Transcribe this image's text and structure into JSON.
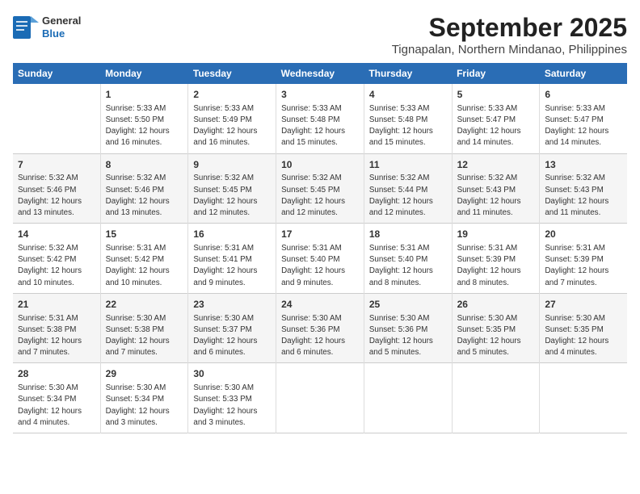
{
  "logo": {
    "line1": "General",
    "line2": "Blue"
  },
  "title": "September 2025",
  "subtitle": "Tignapalan, Northern Mindanao, Philippines",
  "days_header": [
    "Sunday",
    "Monday",
    "Tuesday",
    "Wednesday",
    "Thursday",
    "Friday",
    "Saturday"
  ],
  "weeks": [
    [
      {
        "day": "",
        "info": ""
      },
      {
        "day": "1",
        "info": "Sunrise: 5:33 AM\nSunset: 5:50 PM\nDaylight: 12 hours\nand 16 minutes."
      },
      {
        "day": "2",
        "info": "Sunrise: 5:33 AM\nSunset: 5:49 PM\nDaylight: 12 hours\nand 16 minutes."
      },
      {
        "day": "3",
        "info": "Sunrise: 5:33 AM\nSunset: 5:48 PM\nDaylight: 12 hours\nand 15 minutes."
      },
      {
        "day": "4",
        "info": "Sunrise: 5:33 AM\nSunset: 5:48 PM\nDaylight: 12 hours\nand 15 minutes."
      },
      {
        "day": "5",
        "info": "Sunrise: 5:33 AM\nSunset: 5:47 PM\nDaylight: 12 hours\nand 14 minutes."
      },
      {
        "day": "6",
        "info": "Sunrise: 5:33 AM\nSunset: 5:47 PM\nDaylight: 12 hours\nand 14 minutes."
      }
    ],
    [
      {
        "day": "7",
        "info": "Sunrise: 5:32 AM\nSunset: 5:46 PM\nDaylight: 12 hours\nand 13 minutes."
      },
      {
        "day": "8",
        "info": "Sunrise: 5:32 AM\nSunset: 5:46 PM\nDaylight: 12 hours\nand 13 minutes."
      },
      {
        "day": "9",
        "info": "Sunrise: 5:32 AM\nSunset: 5:45 PM\nDaylight: 12 hours\nand 12 minutes."
      },
      {
        "day": "10",
        "info": "Sunrise: 5:32 AM\nSunset: 5:45 PM\nDaylight: 12 hours\nand 12 minutes."
      },
      {
        "day": "11",
        "info": "Sunrise: 5:32 AM\nSunset: 5:44 PM\nDaylight: 12 hours\nand 12 minutes."
      },
      {
        "day": "12",
        "info": "Sunrise: 5:32 AM\nSunset: 5:43 PM\nDaylight: 12 hours\nand 11 minutes."
      },
      {
        "day": "13",
        "info": "Sunrise: 5:32 AM\nSunset: 5:43 PM\nDaylight: 12 hours\nand 11 minutes."
      }
    ],
    [
      {
        "day": "14",
        "info": "Sunrise: 5:32 AM\nSunset: 5:42 PM\nDaylight: 12 hours\nand 10 minutes."
      },
      {
        "day": "15",
        "info": "Sunrise: 5:31 AM\nSunset: 5:42 PM\nDaylight: 12 hours\nand 10 minutes."
      },
      {
        "day": "16",
        "info": "Sunrise: 5:31 AM\nSunset: 5:41 PM\nDaylight: 12 hours\nand 9 minutes."
      },
      {
        "day": "17",
        "info": "Sunrise: 5:31 AM\nSunset: 5:40 PM\nDaylight: 12 hours\nand 9 minutes."
      },
      {
        "day": "18",
        "info": "Sunrise: 5:31 AM\nSunset: 5:40 PM\nDaylight: 12 hours\nand 8 minutes."
      },
      {
        "day": "19",
        "info": "Sunrise: 5:31 AM\nSunset: 5:39 PM\nDaylight: 12 hours\nand 8 minutes."
      },
      {
        "day": "20",
        "info": "Sunrise: 5:31 AM\nSunset: 5:39 PM\nDaylight: 12 hours\nand 7 minutes."
      }
    ],
    [
      {
        "day": "21",
        "info": "Sunrise: 5:31 AM\nSunset: 5:38 PM\nDaylight: 12 hours\nand 7 minutes."
      },
      {
        "day": "22",
        "info": "Sunrise: 5:30 AM\nSunset: 5:38 PM\nDaylight: 12 hours\nand 7 minutes."
      },
      {
        "day": "23",
        "info": "Sunrise: 5:30 AM\nSunset: 5:37 PM\nDaylight: 12 hours\nand 6 minutes."
      },
      {
        "day": "24",
        "info": "Sunrise: 5:30 AM\nSunset: 5:36 PM\nDaylight: 12 hours\nand 6 minutes."
      },
      {
        "day": "25",
        "info": "Sunrise: 5:30 AM\nSunset: 5:36 PM\nDaylight: 12 hours\nand 5 minutes."
      },
      {
        "day": "26",
        "info": "Sunrise: 5:30 AM\nSunset: 5:35 PM\nDaylight: 12 hours\nand 5 minutes."
      },
      {
        "day": "27",
        "info": "Sunrise: 5:30 AM\nSunset: 5:35 PM\nDaylight: 12 hours\nand 4 minutes."
      }
    ],
    [
      {
        "day": "28",
        "info": "Sunrise: 5:30 AM\nSunset: 5:34 PM\nDaylight: 12 hours\nand 4 minutes."
      },
      {
        "day": "29",
        "info": "Sunrise: 5:30 AM\nSunset: 5:34 PM\nDaylight: 12 hours\nand 3 minutes."
      },
      {
        "day": "30",
        "info": "Sunrise: 5:30 AM\nSunset: 5:33 PM\nDaylight: 12 hours\nand 3 minutes."
      },
      {
        "day": "",
        "info": ""
      },
      {
        "day": "",
        "info": ""
      },
      {
        "day": "",
        "info": ""
      },
      {
        "day": "",
        "info": ""
      }
    ]
  ]
}
